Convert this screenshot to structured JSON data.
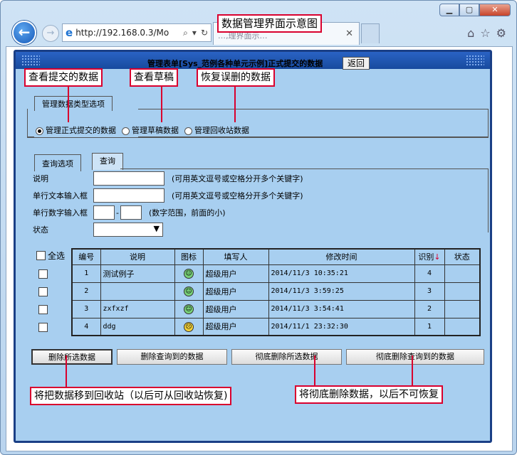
{
  "browser": {
    "url": "http://192.168.0.3/Mo",
    "tab_title": "…‚理界面示…",
    "win_buttons": [
      "▁",
      "▢",
      "✕"
    ],
    "icons": [
      "home-icon",
      "star-icon",
      "gear-icon"
    ]
  },
  "frame": {
    "title": "管理表单[Sys_范例各种单元示例]正式提交的数据",
    "back_button": "返回"
  },
  "type_tab": {
    "label": "管理数据类型选项",
    "options": [
      {
        "label": "管理正式提交的数据",
        "selected": true
      },
      {
        "label": "管理草稿数据",
        "selected": false
      },
      {
        "label": "管理回收站数据",
        "selected": false
      }
    ]
  },
  "query_tab": {
    "label": "查询选项",
    "query_button": "查询",
    "fields": [
      {
        "label": "说明",
        "hint": "(可用英文逗号或空格分开多个关键字)"
      },
      {
        "label": "单行文本输入框",
        "hint": "(可用英文逗号或空格分开多个关键字)"
      },
      {
        "label": "单行数字输入框",
        "separator": "-",
        "hint": "(数字范围，前面的小)"
      },
      {
        "label": "状态"
      }
    ]
  },
  "table": {
    "select_all": "全选",
    "headers": [
      "编号",
      "说明",
      "图标",
      "填写人",
      "修改时间",
      "识别",
      "状态"
    ],
    "sort_arrow": "↓",
    "rows": [
      {
        "id": "1",
        "desc": "测试例子",
        "user": "超级用户",
        "time": "2014/11/3 10:35:21",
        "ident": "4",
        "icon": "green"
      },
      {
        "id": "2",
        "desc": "",
        "user": "超级用户",
        "time": "2014/11/3 3:59:25",
        "ident": "3",
        "icon": "green"
      },
      {
        "id": "3",
        "desc": "zxfxzf",
        "user": "超级用户",
        "time": "2014/11/3 3:54:41",
        "ident": "2",
        "icon": "green"
      },
      {
        "id": "4",
        "desc": "ddg",
        "user": "超级用户",
        "time": "2014/11/1 23:32:30",
        "ident": "1",
        "icon": "yellow"
      }
    ]
  },
  "actions": [
    "删除所选数据",
    "删除查询到的数据",
    "彻底删除所选数据",
    "彻底删除查询到的数据"
  ],
  "annotations": {
    "title": "数据管理界面示意图",
    "submitted": "查看提交的数据",
    "draft": "查看草稿",
    "recycle": "恢复误删的数据",
    "delete_note": "将把数据移到回收站（以后可从回收站恢复)",
    "purge_note": "将彻底删除数据，以后不可恢复"
  },
  "colors": {
    "annotation_border": "#d9002e",
    "frame_border": "#1a3f86",
    "panel_bg": "#a8cff0"
  }
}
